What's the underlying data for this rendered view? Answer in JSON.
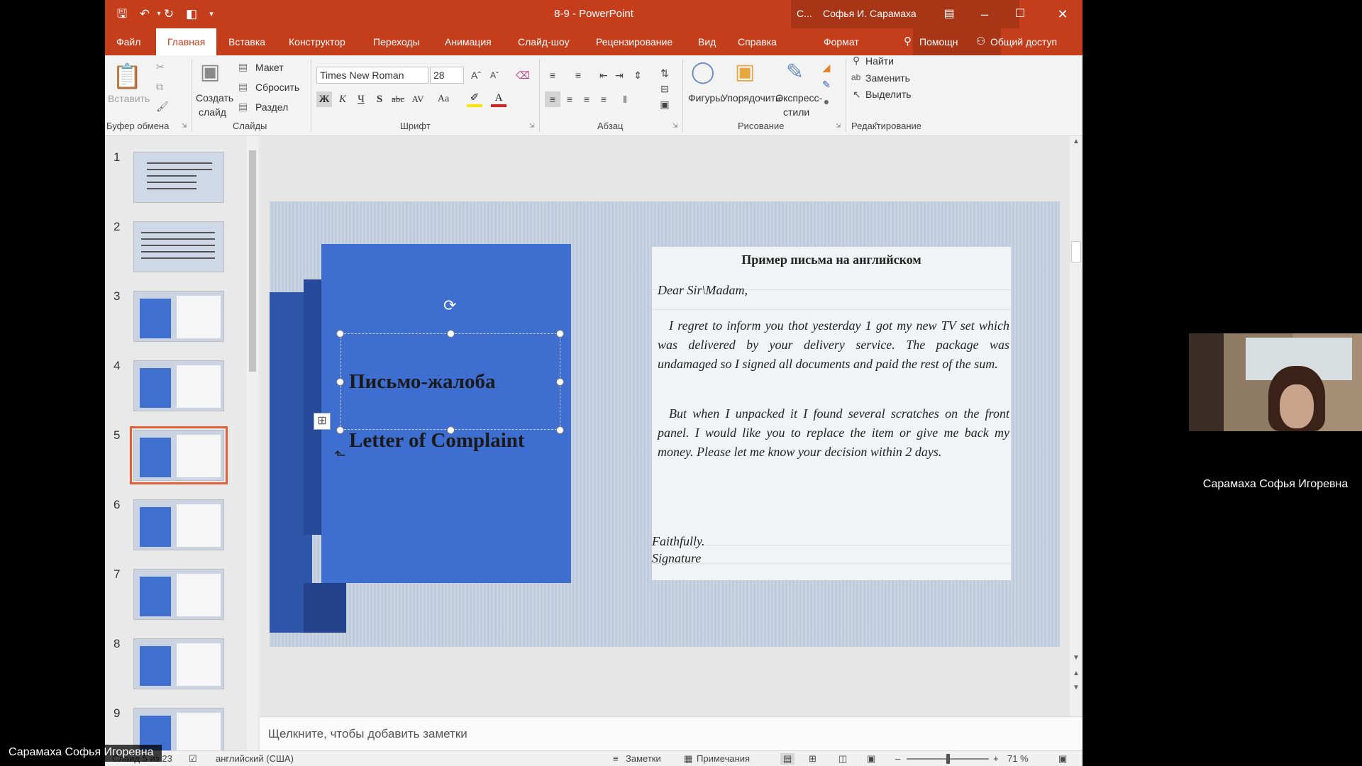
{
  "window": {
    "doc_title": "8-9  -  PowerPoint",
    "account_initials": "С...",
    "account_name": "Софья И. Сарамаха"
  },
  "tabs": {
    "file": "Файл",
    "home": "Главная",
    "insert": "Вставка",
    "design": "Конструктор",
    "transitions": "Переходы",
    "animation": "Анимация",
    "slideshow": "Слайд-шоу",
    "review": "Рецензирование",
    "view": "Вид",
    "help": "Справка",
    "format": "Формат",
    "tell_me": "Помощн",
    "share": "Общий доступ"
  },
  "ribbon": {
    "clipboard": {
      "label": "Буфер обмена",
      "paste": "Вставить"
    },
    "slides": {
      "label": "Слайды",
      "new_slide_1": "Создать",
      "new_slide_2": "слайд",
      "layout": "Макет",
      "reset": "Сбросить",
      "section": "Раздел"
    },
    "font": {
      "label": "Шрифт",
      "font_name": "Times New Roman",
      "font_size": "28",
      "bold": "Ж",
      "italic": "К",
      "underline": "Ч",
      "shadow": "S",
      "strike": "abc",
      "case": "Aa"
    },
    "paragraph": {
      "label": "Абзац"
    },
    "drawing": {
      "label": "Рисование",
      "shapes": "Фигуры",
      "arrange": "Упорядочить",
      "quick_styles_1": "Экспресс-",
      "quick_styles_2": "стили"
    },
    "editing": {
      "label": "Редактирование",
      "find": "Найти",
      "replace": "Заменить",
      "select": "Выделить"
    }
  },
  "thumbnails": {
    "numbers": [
      "1",
      "2",
      "3",
      "4",
      "5",
      "6",
      "7",
      "8",
      "9"
    ],
    "selected": 5
  },
  "slide": {
    "title_ru": "Письмо-жалоба",
    "title_en": "Letter of Complaint",
    "letter_title": "Пример письма на английском",
    "salutation": "Dear Sir\\Madam,",
    "para1": "I regret to inform you thot yesterday 1 got my new TV set which was delivered by your delivery service. The package was undamaged so I signed all documents and paid the rest of the sum.",
    "para2": "But when I unpacked it I found several scratches on the front panel. I would like you to replace the item or give me back my money. Please let me know your decision within 2 days.",
    "closing": "Faithfully.",
    "signature": "Signature"
  },
  "notes": {
    "placeholder": "Щелкните, чтобы добавить заметки"
  },
  "status": {
    "slide_info": "Слайд 5 из 23",
    "language": "английский (США)",
    "notes_btn": "Заметки",
    "comments_btn": "Примечания",
    "zoom": "71 %"
  },
  "webcam": {
    "name": "Сарамаха Софья Игоревна"
  },
  "overlay": {
    "name": "Сарамаха Софья Игоревна"
  },
  "colors": {
    "accent": "#c43e1c",
    "slide_blue": "#3e6ed0",
    "selection": "#e0603a"
  }
}
